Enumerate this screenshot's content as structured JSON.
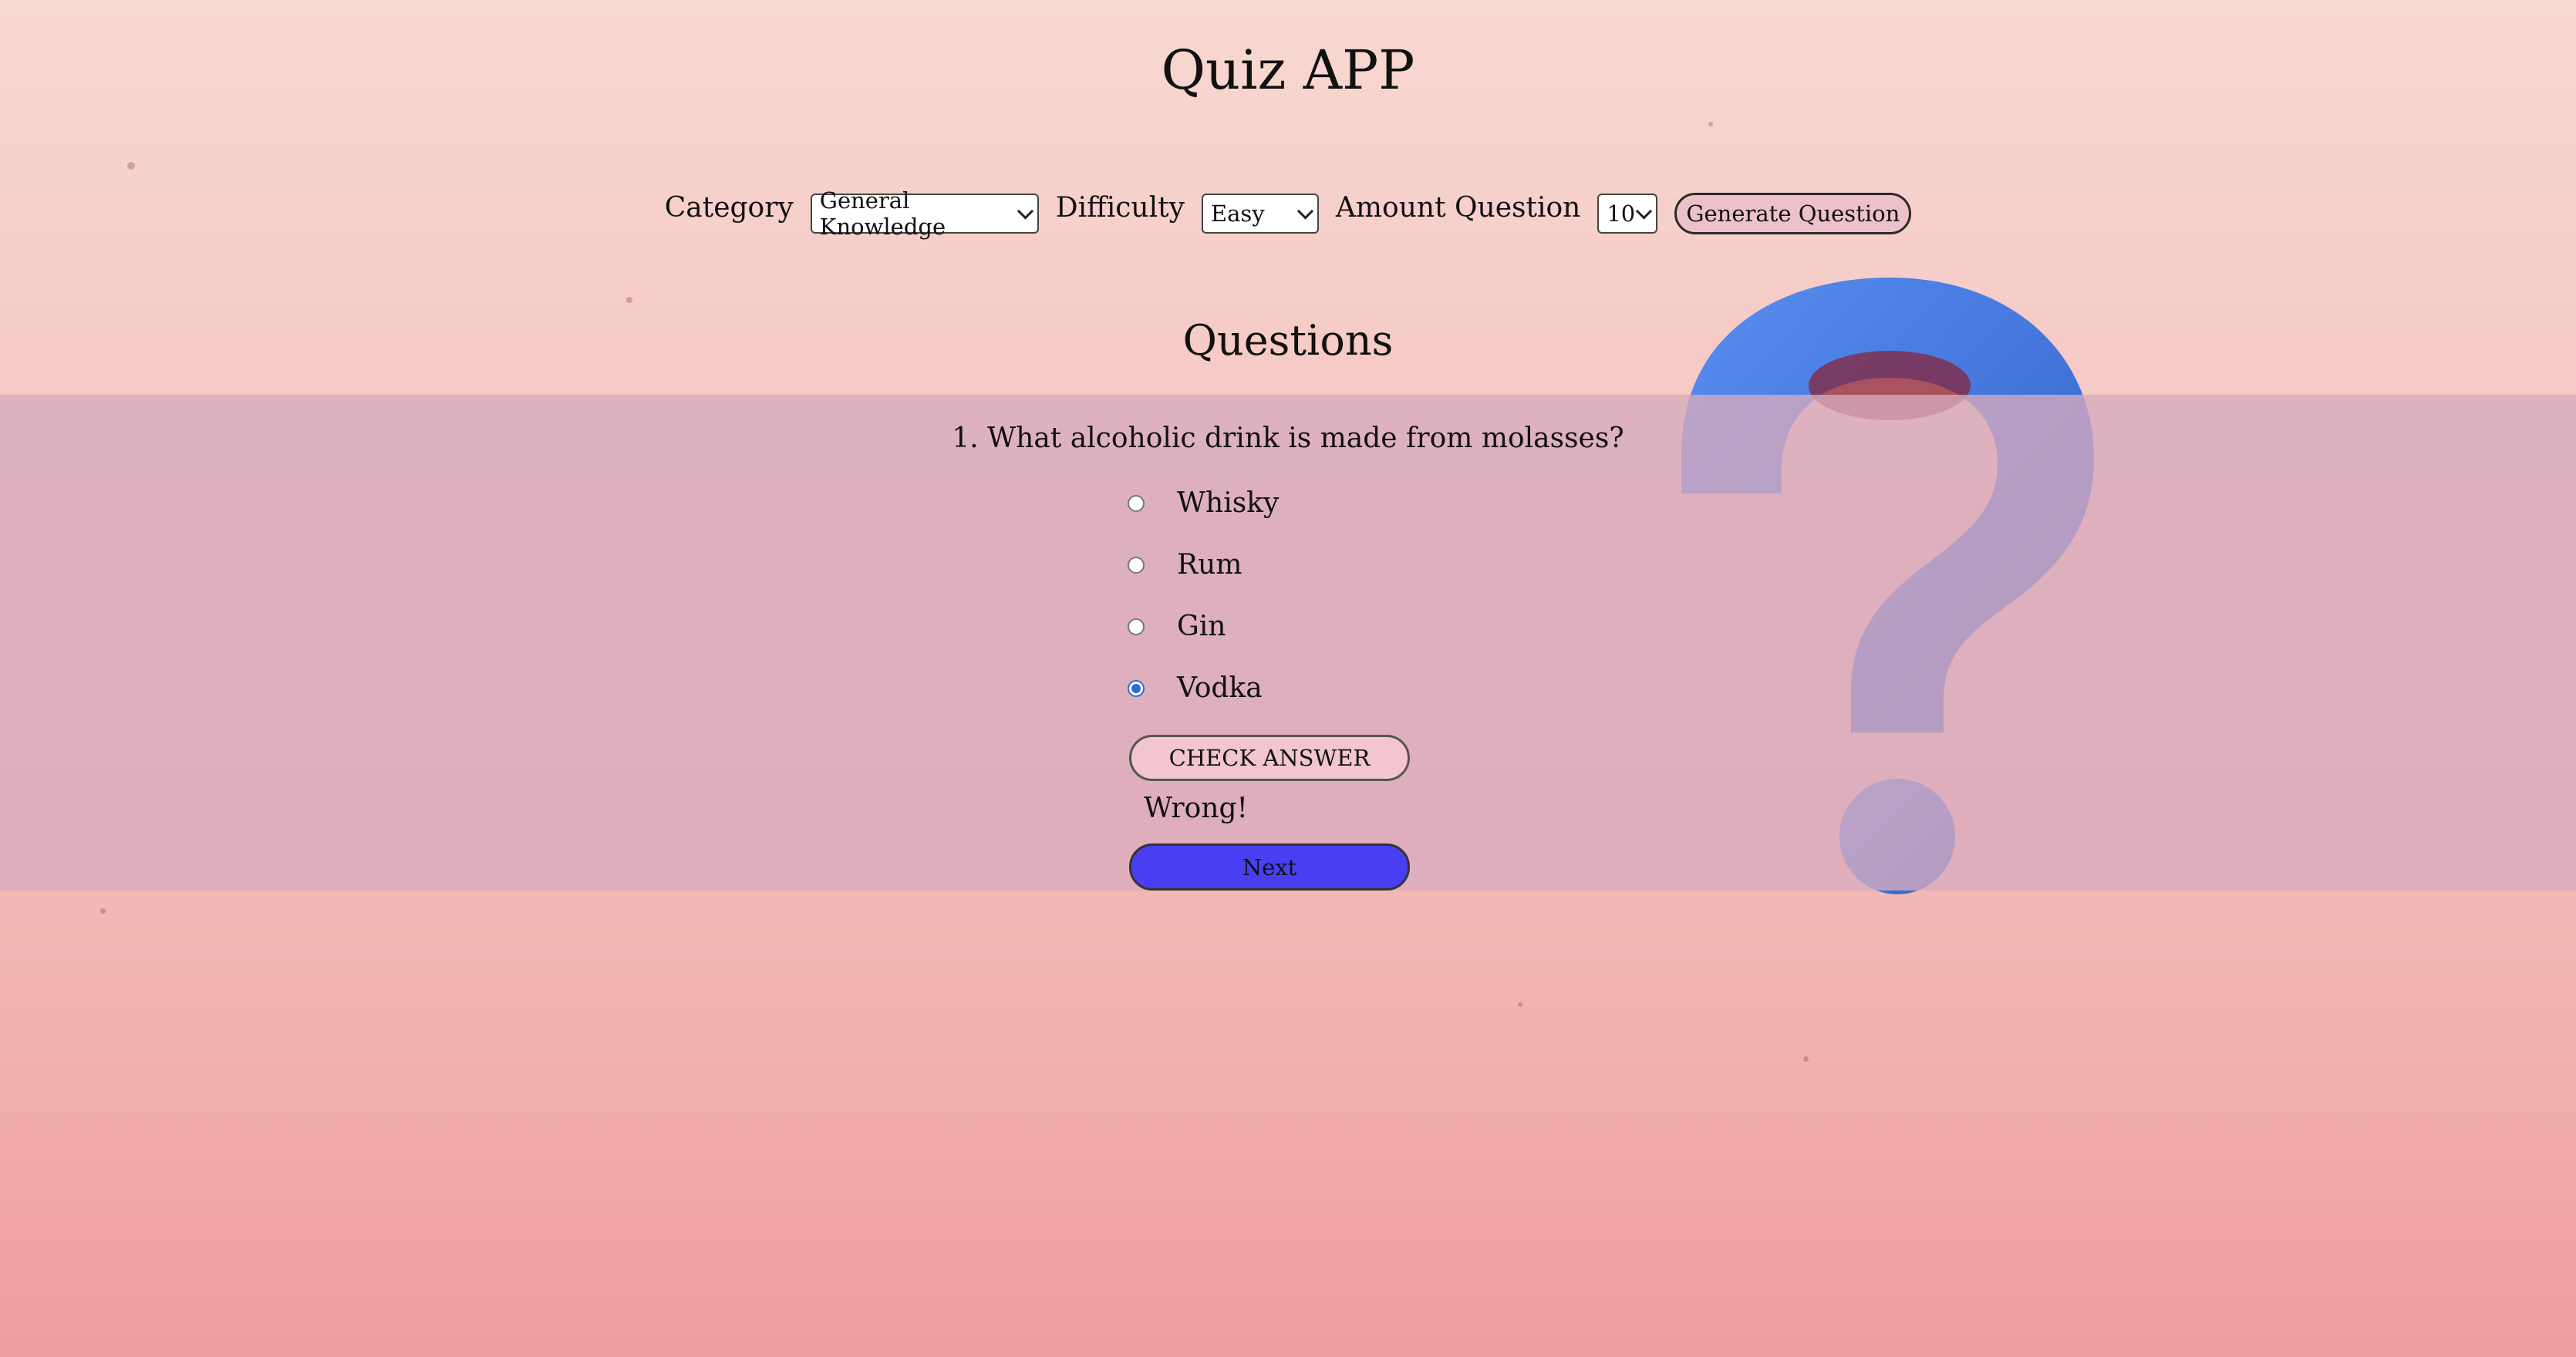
{
  "app": {
    "title": "Quiz APP"
  },
  "controls": {
    "category_label": "Category",
    "category_value": "General Knowledge",
    "difficulty_label": "Difficulty",
    "difficulty_value": "Easy",
    "amount_label": "Amount Question",
    "amount_value": "10",
    "generate_label": "Generate Question"
  },
  "questions": {
    "heading": "Questions",
    "current": {
      "text": "1. What alcoholic drink is made from molasses?",
      "options": [
        {
          "label": "Whisky",
          "checked": false
        },
        {
          "label": "Rum",
          "checked": false
        },
        {
          "label": "Gin",
          "checked": false
        },
        {
          "label": "Vodka",
          "checked": true
        }
      ]
    },
    "check_label": "CHECK ANSWER",
    "result": "Wrong!",
    "next_label": "Next"
  },
  "colors": {
    "panel": "#d7aabe",
    "next_button": "#4a3ff0",
    "check_button": "#f2c5cf",
    "radio_selected": "#2a6bd6",
    "question_mark": "#3f73d8"
  },
  "icons": {
    "background": "question-mark-icon"
  }
}
